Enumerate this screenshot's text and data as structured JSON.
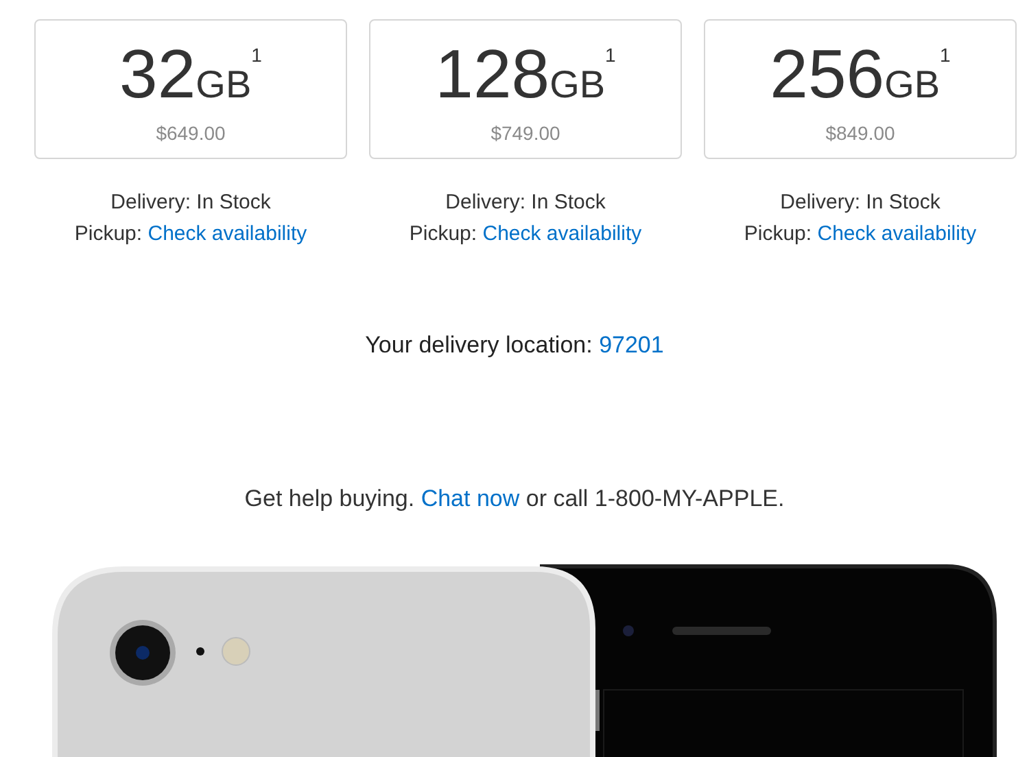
{
  "options": [
    {
      "capacity": "32",
      "unit": "GB",
      "footnote": "1",
      "price": "$649.00",
      "delivery": "Delivery: In Stock",
      "pickup_label": "Pickup:",
      "pickup_link": "Check availability"
    },
    {
      "capacity": "128",
      "unit": "GB",
      "footnote": "1",
      "price": "$749.00",
      "delivery": "Delivery: In Stock",
      "pickup_label": "Pickup:",
      "pickup_link": "Check availability"
    },
    {
      "capacity": "256",
      "unit": "GB",
      "footnote": "1",
      "price": "$849.00",
      "delivery": "Delivery: In Stock",
      "pickup_label": "Pickup:",
      "pickup_link": "Check availability"
    }
  ],
  "delivery_location": {
    "label": "Your delivery location:",
    "zip": "97201"
  },
  "help": {
    "before": "Get help buying.",
    "link": "Chat now",
    "after": "or call 1-800-MY-APPLE."
  }
}
